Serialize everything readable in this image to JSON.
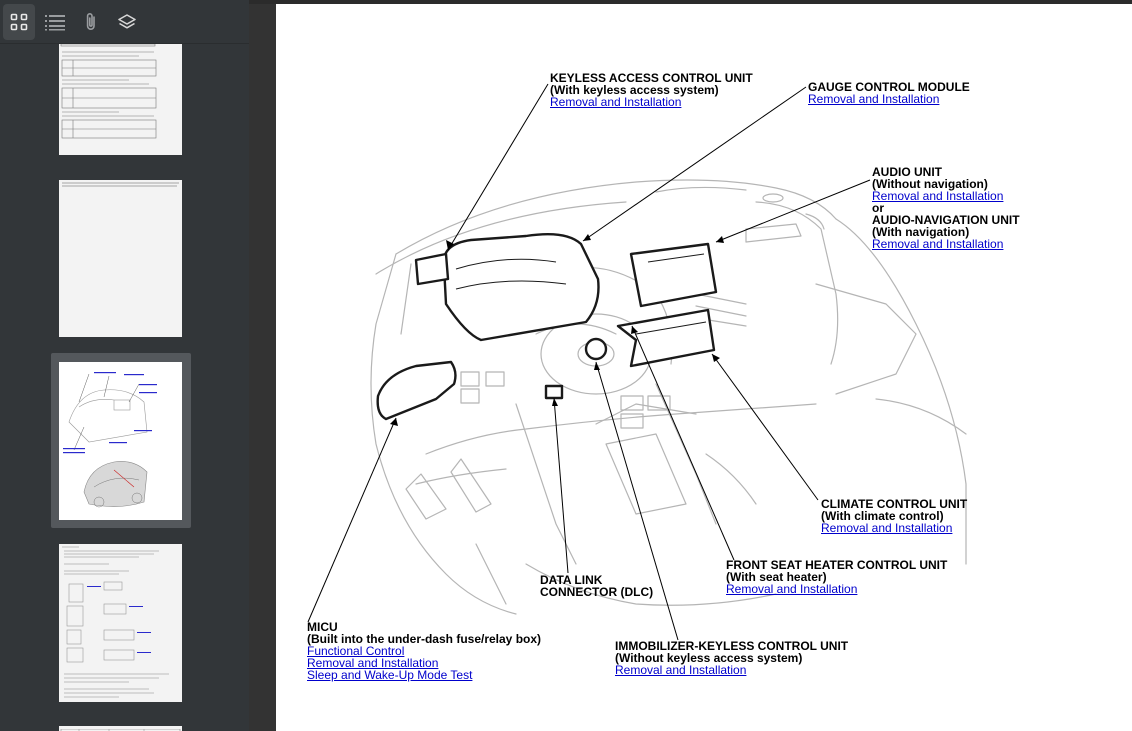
{
  "toolbar": {
    "buttons": [
      {
        "name": "thumbnails",
        "icon": "grid-icon",
        "active": true
      },
      {
        "name": "outline",
        "icon": "list-icon"
      },
      {
        "name": "attachments",
        "icon": "paperclip-icon"
      },
      {
        "name": "layers",
        "icon": "layers-icon"
      }
    ]
  },
  "thumbnails": {
    "selected_index": 2
  },
  "diagram": {
    "labels": {
      "keyless": {
        "title1": "KEYLESS ACCESS CONTROL UNIT",
        "title2": "(With keyless access system)",
        "link1": "Removal and Installation"
      },
      "gauge": {
        "title1": "GAUGE CONTROL MODULE",
        "link1": "Removal and Installation"
      },
      "audio": {
        "title1": "AUDIO UNIT",
        "title2": "(Without navigation)",
        "link1": "Removal and Installation",
        "or": "or",
        "title3": "AUDIO-NAVIGATION UNIT",
        "title4": "(With navigation)",
        "link2": "Removal and Installation"
      },
      "climate": {
        "title1": "CLIMATE CONTROL UNIT",
        "title2": "(With climate control)",
        "link1": "Removal and Installation"
      },
      "seat": {
        "title1": "FRONT SEAT HEATER CONTROL UNIT",
        "title2": "(With seat heater)",
        "link1": "Removal and Installation"
      },
      "dlc": {
        "title1": "DATA LINK",
        "title2": "CONNECTOR (DLC)"
      },
      "micu": {
        "title1": "MICU",
        "title2": "(Built into the under-dash fuse/relay box)",
        "link1": "Functional Control",
        "link2": "Removal and Installation",
        "link3": "Sleep and Wake-Up Mode Test"
      },
      "immo": {
        "title1": "IMMOBILIZER-KEYLESS CONTROL UNIT",
        "title2": "(Without keyless access system)",
        "link1": "Removal and Installation"
      }
    }
  },
  "colors": {
    "link": "#0000cc",
    "sidebar_bg": "#323639",
    "page_bg": "#ffffff"
  }
}
